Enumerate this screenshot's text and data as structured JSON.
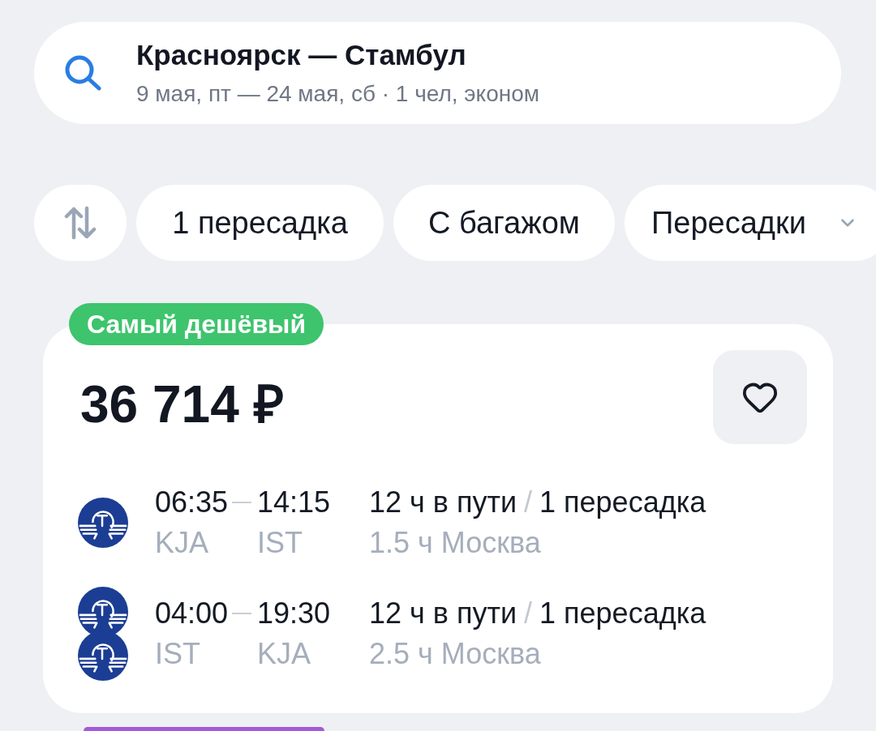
{
  "search": {
    "title": "Красноярск — Стамбул",
    "subtitle": "9 мая, пт — 24 мая, сб · 1 чел, эконом"
  },
  "filters": [
    {
      "kind": "sort",
      "selected": false
    },
    {
      "kind": "chip",
      "label": "1 пересадка",
      "selected": false
    },
    {
      "kind": "chip",
      "label": "С багажом",
      "selected": false
    },
    {
      "kind": "dropdown",
      "label": "Пересадки",
      "selected": false
    }
  ],
  "offers": [
    {
      "kind": "card",
      "badge": "Самый дешёвый",
      "color": "#3ec46d",
      "price": "36 714 ₽",
      "favorite": false,
      "flights": [
        {
          "airlines": [
            {
              "kind": "emblem"
            }
          ],
          "depart_time": "06:35",
          "arrive_time": "14:15",
          "from": "KJA",
          "to": "IST",
          "duration": "12 ч в пути",
          "separator": "/",
          "stops": "1 пересадка",
          "layover": "1.5 ч Москва"
        },
        {
          "airlines": [
            {
              "kind": "emblem"
            },
            {
              "kind": "emblem"
            }
          ],
          "depart_time": "04:00",
          "arrive_time": "19:30",
          "from": "IST",
          "to": "KJA",
          "duration": "12 ч в пути",
          "separator": "/",
          "stops": "1 пересадка",
          "layover": "2.5 ч Москва"
        }
      ]
    },
    {
      "kind": "edge",
      "color": "#a35bd8"
    }
  ]
}
